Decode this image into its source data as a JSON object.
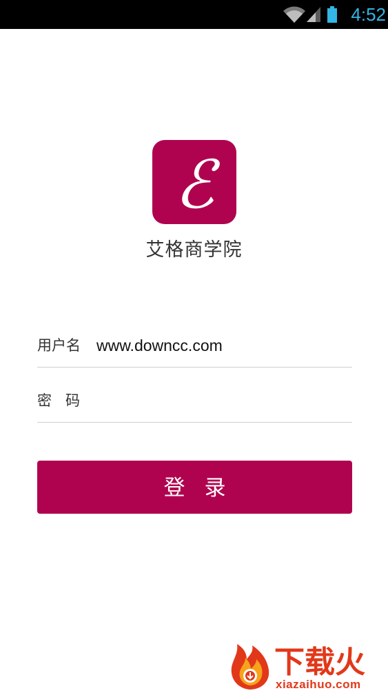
{
  "status_bar": {
    "time": "4:52",
    "icons": [
      "wifi-icon",
      "signal-icon",
      "battery-icon"
    ],
    "accent_color": "#33b5e5"
  },
  "app": {
    "logo_letter": "ℰ",
    "name": "艾格商学院",
    "brand_color": "#b0034f"
  },
  "form": {
    "username_label": "用户名",
    "username_value": "www.downcc.com",
    "password_label": "密码",
    "password_value": "",
    "login_label": "登录"
  },
  "watermark": {
    "text_cn": "下载火",
    "text_en": "xiazaihuo.com",
    "color": "#e2381a"
  }
}
